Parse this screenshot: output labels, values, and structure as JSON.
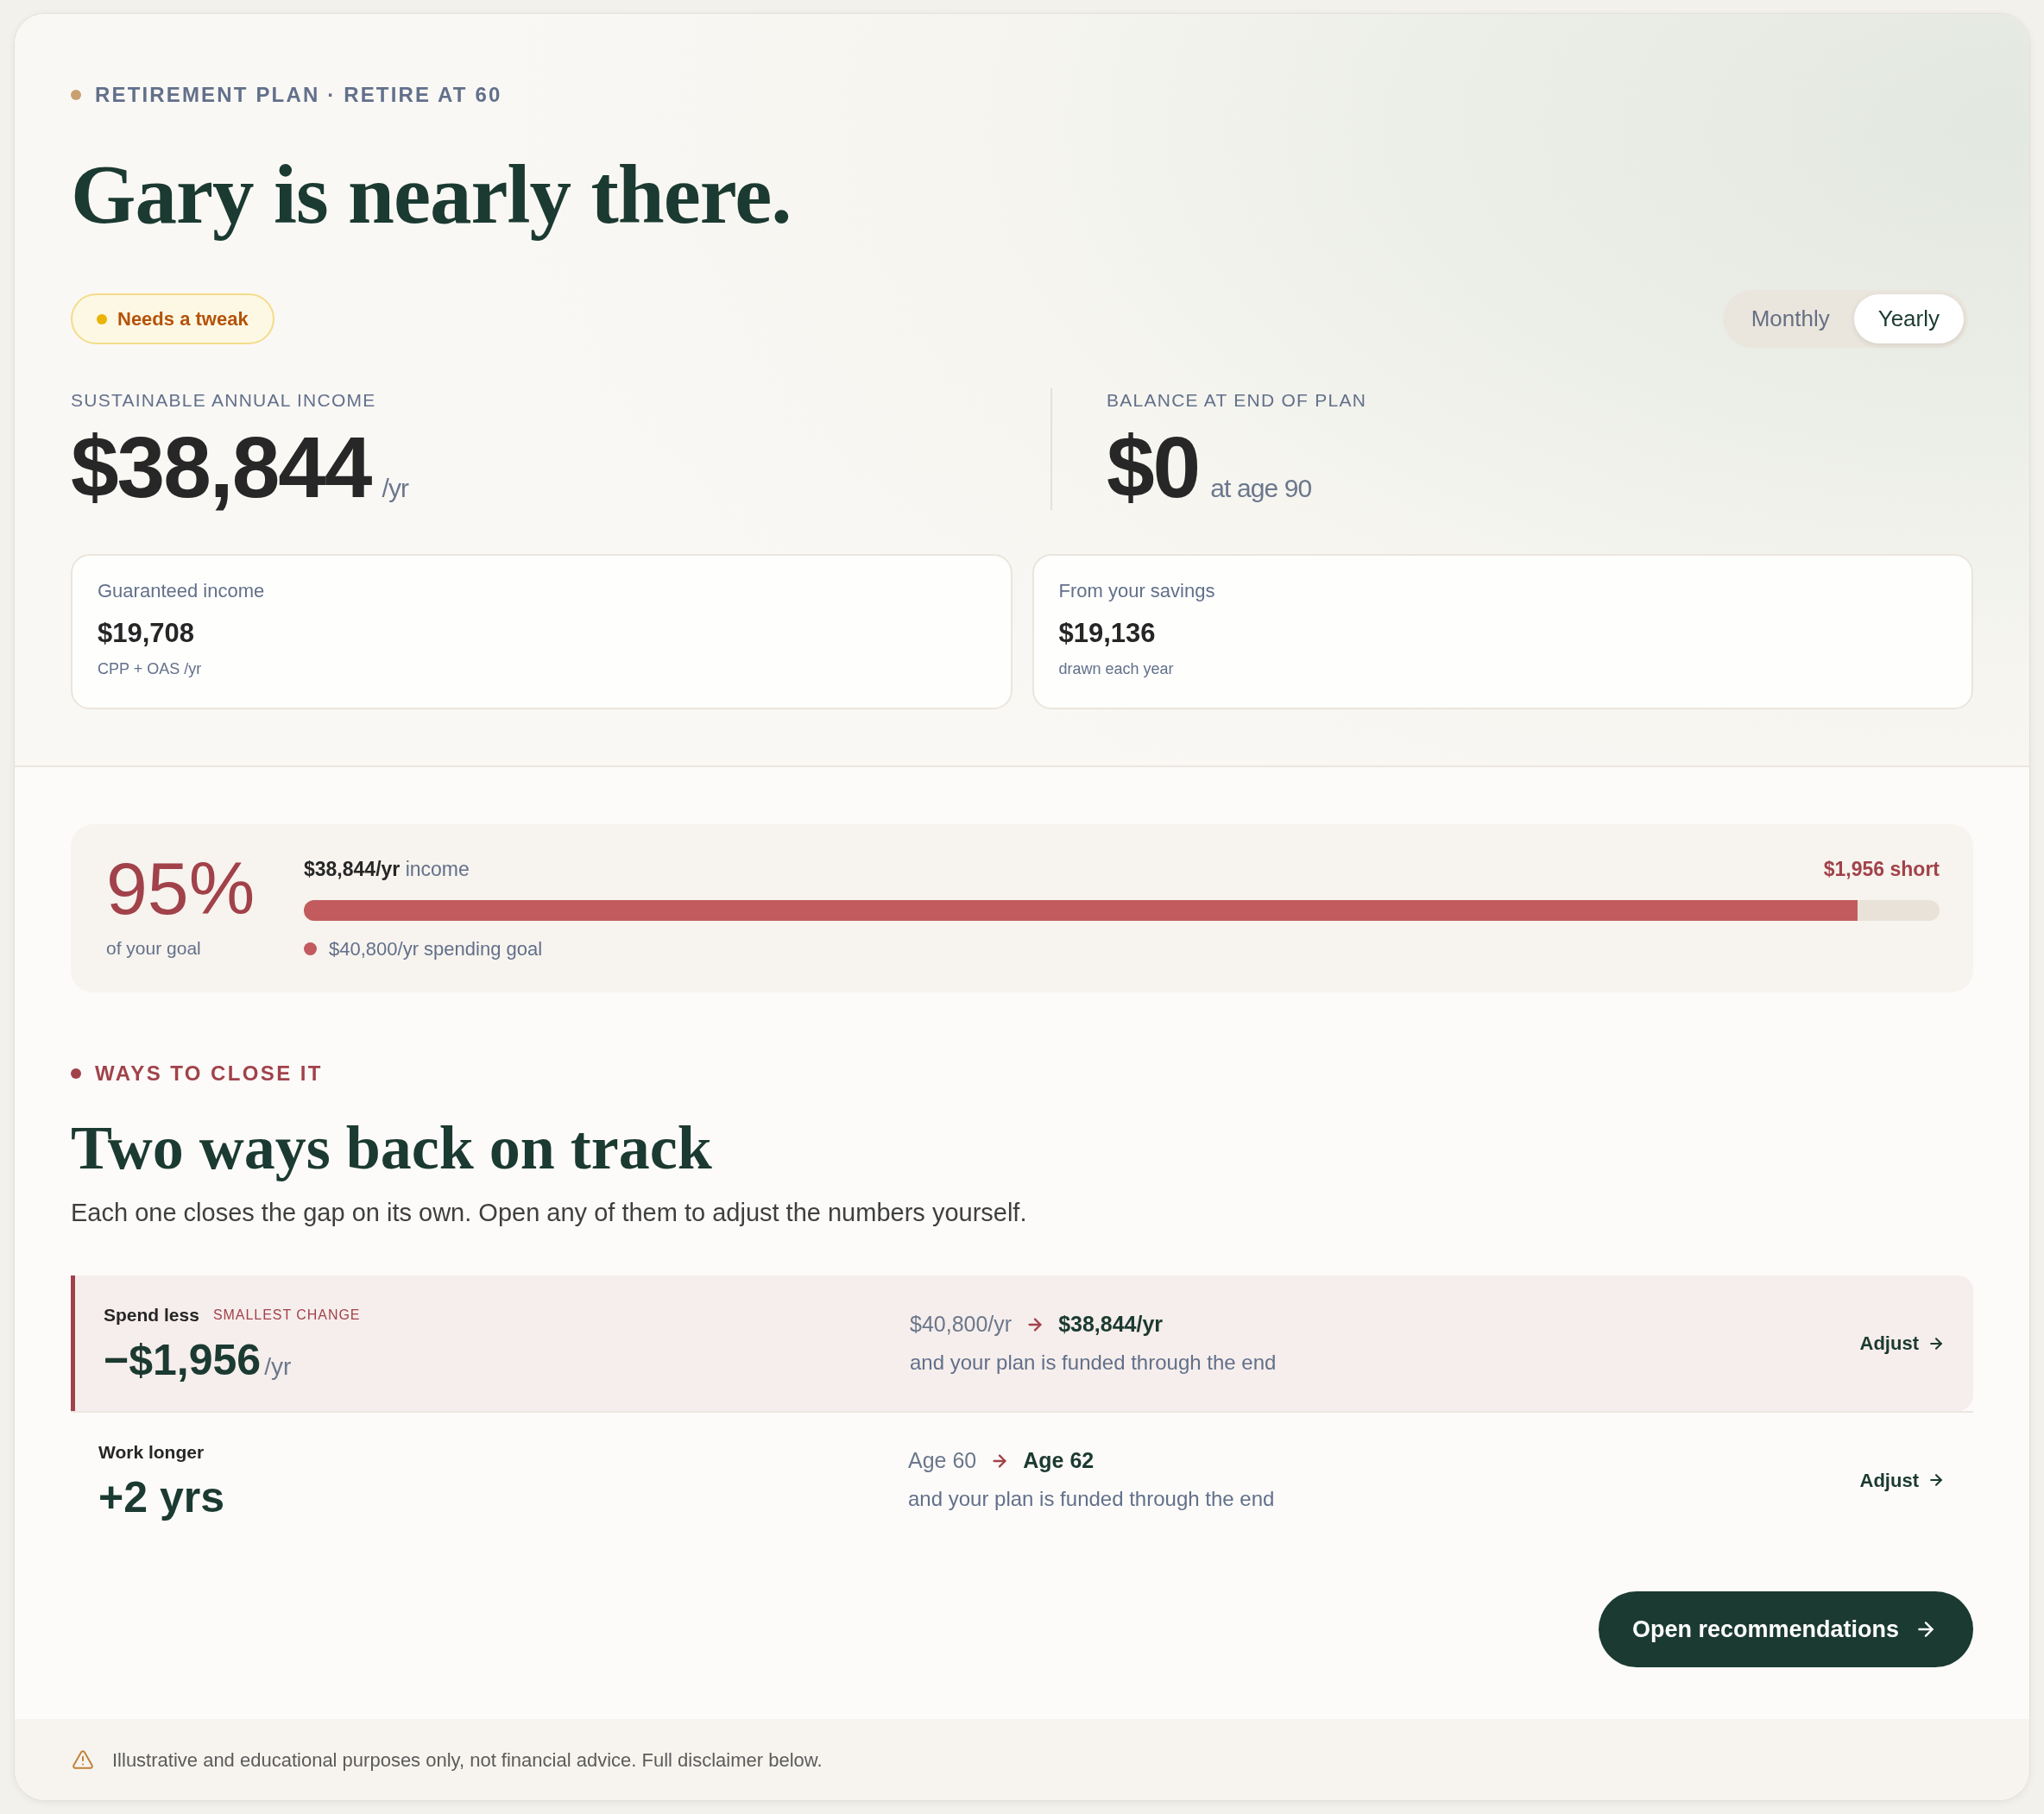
{
  "header": {
    "eyebrow": "RETIREMENT PLAN · RETIRE AT 60",
    "title": "Gary is nearly there.",
    "status": "Needs a tweak",
    "period_toggle": [
      {
        "label": "Monthly",
        "selected": false
      },
      {
        "label": "Yearly",
        "selected": true
      }
    ]
  },
  "metrics": [
    {
      "label": "SUSTAINABLE ANNUAL INCOME",
      "value": "$38,844",
      "unit": "/yr"
    },
    {
      "label": "BALANCE AT END OF PLAN",
      "value": "$0",
      "unit": "at age 90"
    }
  ],
  "breakdown": [
    {
      "label": "Guaranteed income",
      "value": "$19,708",
      "note": "CPP + OAS /yr"
    },
    {
      "label": "From your savings",
      "value": "$19,136",
      "note": "drawn each year"
    }
  ],
  "goal_progress": {
    "percent": "95%",
    "caption": "of your goal",
    "income": "**$38,844/yr** income",
    "shortfall": "$1,956 short",
    "level": 0.95,
    "goal": "$40,800/yr spending goal"
  },
  "ways": {
    "eyebrow": "WAYS TO CLOSE IT",
    "title": "Two ways back on track",
    "subtitle": "Each one closes the gap on its own. Open any of them to adjust the numbers yourself.",
    "options": [
      {
        "name": "Spend less",
        "tag": "SMALLEST CHANGE",
        "value": "−$1,956",
        "unit": "/yr",
        "from": "$40,800/yr",
        "to": "$38,844/yr",
        "note": "and your plan is funded through the end",
        "action": "Adjust",
        "highlighted": true
      },
      {
        "name": "Work longer",
        "value": "+2 yrs",
        "from": "Age 60",
        "to": "Age 62",
        "note": "and your plan is funded through the end",
        "action": "Adjust",
        "highlighted": false
      }
    ]
  },
  "cta": "Open recommendations",
  "disclaimer": "Illustrative and educational purposes only, not financial advice. Full disclaimer below."
}
